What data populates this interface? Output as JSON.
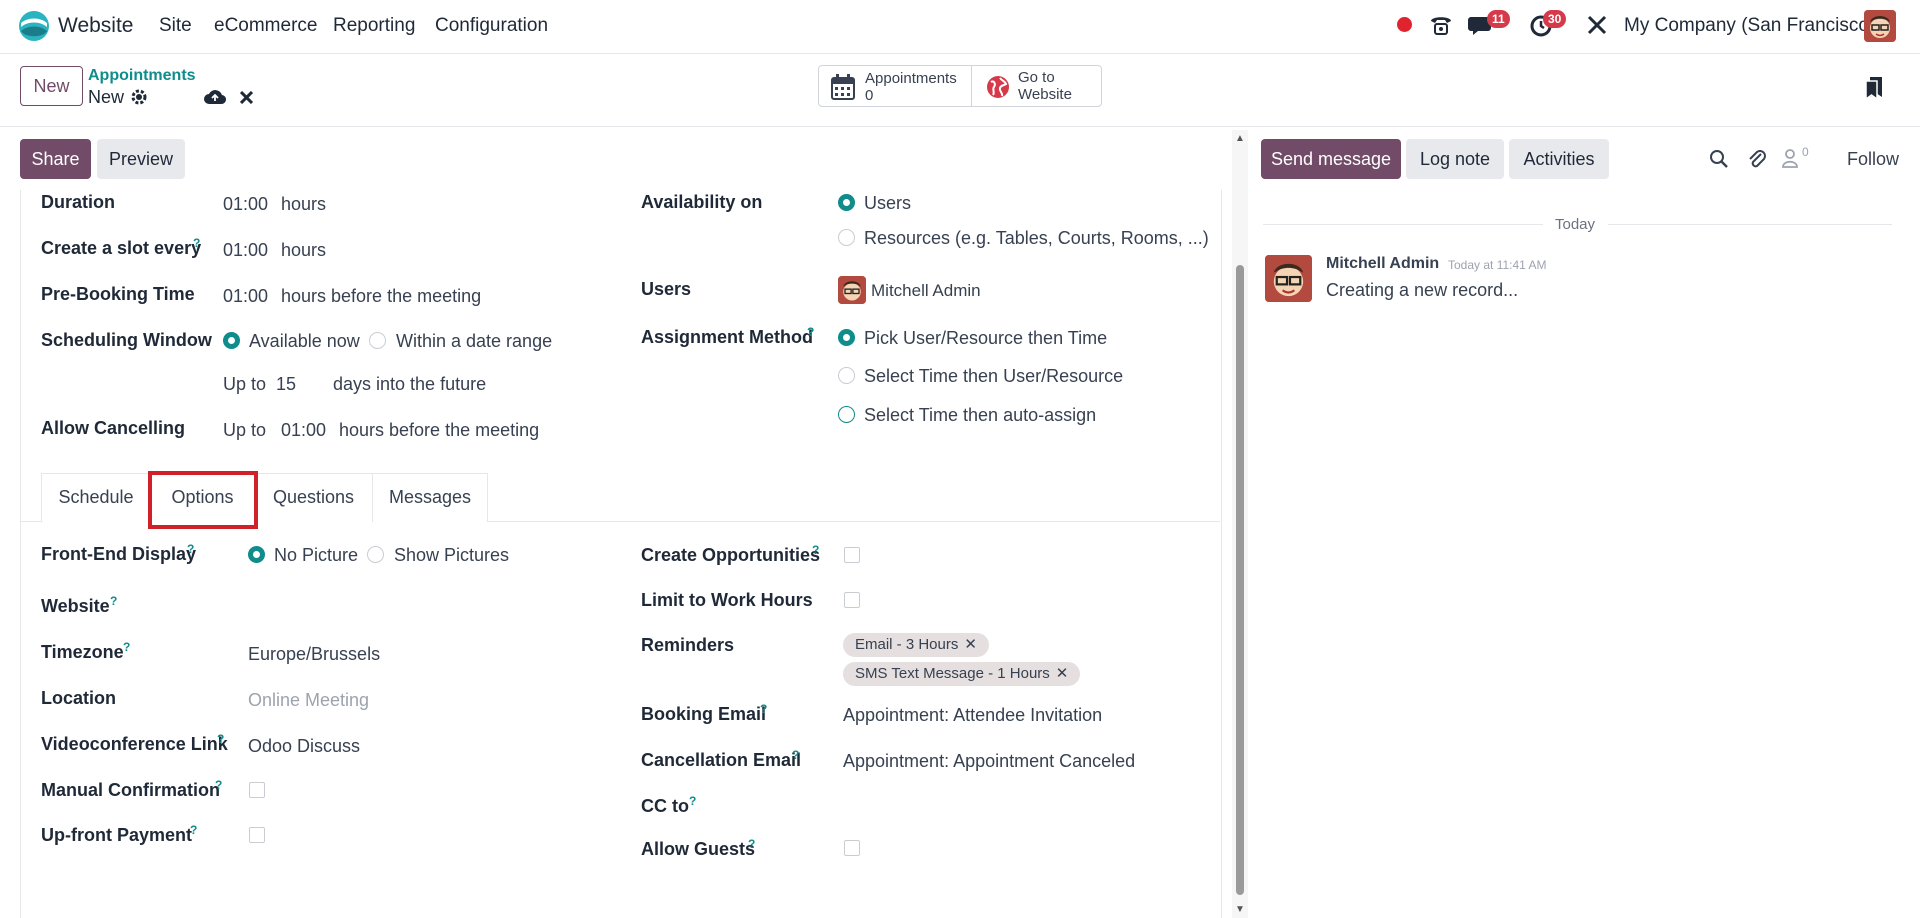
{
  "navbar": {
    "app_name": "Website",
    "menu": [
      "Site",
      "eCommerce",
      "Reporting",
      "Configuration"
    ],
    "chat_count": "11",
    "activity_count": "30",
    "company": "My Company (San Francisco)"
  },
  "control": {
    "new_label": "New",
    "breadcrumb": "Appointments",
    "record": "New",
    "smart_appointments_label": "Appointments",
    "smart_appointments_count": "0",
    "smart_website_line1": "Go to",
    "smart_website_line2": "Website"
  },
  "actions": {
    "share": "Share",
    "preview": "Preview"
  },
  "form": {
    "duration_label": "Duration",
    "duration_value": "01:00",
    "duration_unit": "hours",
    "slot_label": "Create a slot every",
    "slot_value": "01:00",
    "slot_unit": "hours",
    "prebook_label": "Pre-Booking Time",
    "prebook_value": "01:00",
    "prebook_unit": "hours before the meeting",
    "window_label": "Scheduling Window",
    "window_opt1": "Available now",
    "window_opt2": "Within a date range",
    "upto_label": "Up to",
    "upto_value": "15",
    "upto_unit": "days into the future",
    "cancel_label": "Allow Cancelling",
    "cancel_upto": "Up to",
    "cancel_value": "01:00",
    "cancel_unit": "hours before the meeting",
    "availability_label": "Availability on",
    "availability_opt1": "Users",
    "availability_opt2": "Resources (e.g. Tables, Courts, Rooms, ...)",
    "users_label": "Users",
    "users_value": "Mitchell Admin",
    "assignment_label": "Assignment Method",
    "assignment_opt1": "Pick User/Resource then Time",
    "assignment_opt2": "Select Time then User/Resource",
    "assignment_opt3": "Select Time then auto-assign"
  },
  "tabs": [
    "Schedule",
    "Options",
    "Questions",
    "Messages"
  ],
  "options": {
    "frontend_label": "Front-End Display",
    "frontend_opt1": "No Picture",
    "frontend_opt2": "Show Pictures",
    "website_label": "Website",
    "timezone_label": "Timezone",
    "timezone_value": "Europe/Brussels",
    "location_label": "Location",
    "location_placeholder": "Online Meeting",
    "video_label": "Videoconference Link",
    "video_value": "Odoo Discuss",
    "manual_label": "Manual Confirmation",
    "upfront_label": "Up-front Payment",
    "opps_label": "Create Opportunities",
    "workhours_label": "Limit to Work Hours",
    "reminders_label": "Reminders",
    "reminder1": "Email - 3 Hours",
    "reminder2": "SMS Text Message - 1 Hours",
    "booking_label": "Booking Email",
    "booking_value": "Appointment: Attendee Invitation",
    "cancellation_label": "Cancellation Email",
    "cancellation_value": "Appointment: Appointment Canceled",
    "cc_label": "CC to",
    "guests_label": "Allow Guests"
  },
  "chatter": {
    "send_message": "Send message",
    "log_note": "Log note",
    "activities": "Activities",
    "follower_count": "0",
    "follow": "Follow",
    "date_separator": "Today",
    "author": "Mitchell Admin",
    "time": "Today at 11:41 AM",
    "message": "Creating a new record..."
  },
  "colors": {
    "primary": "#714b67",
    "accent": "#0f8c8c",
    "badge": "#d63a4a",
    "highlight_box": "#d0202a"
  }
}
